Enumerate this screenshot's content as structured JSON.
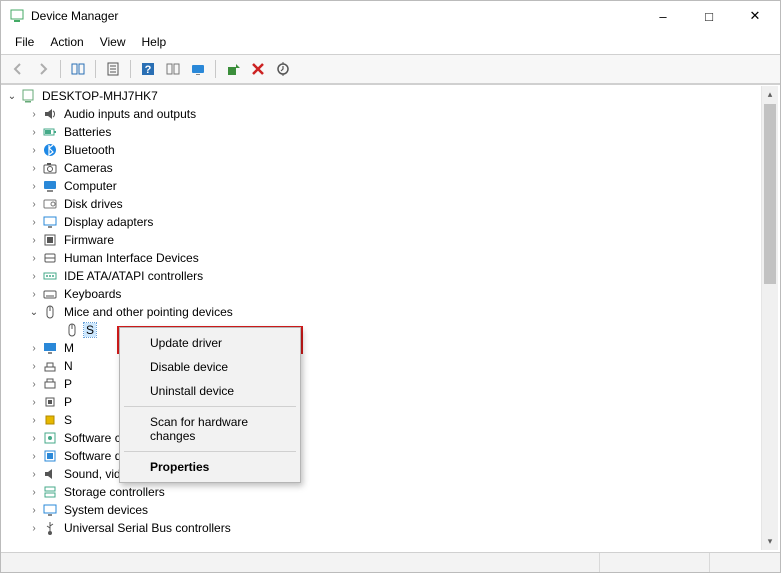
{
  "titlebar": {
    "title": "Device Manager"
  },
  "menubar": {
    "items": [
      "File",
      "Action",
      "View",
      "Help"
    ]
  },
  "toolbar": {
    "buttons": [
      {
        "name": "back",
        "enabled": false
      },
      {
        "name": "forward",
        "enabled": false
      },
      {
        "sep": true
      },
      {
        "name": "show-hide-tree",
        "enabled": true
      },
      {
        "sep": true
      },
      {
        "name": "properties",
        "enabled": true
      },
      {
        "sep": true
      },
      {
        "name": "help",
        "enabled": true
      },
      {
        "name": "show-hidden",
        "enabled": true
      },
      {
        "name": "computer-props",
        "enabled": true
      },
      {
        "sep": true
      },
      {
        "name": "update-driver",
        "enabled": true
      },
      {
        "name": "uninstall",
        "enabled": true
      },
      {
        "name": "scan-hardware",
        "enabled": true
      }
    ]
  },
  "tree": {
    "root": {
      "label": "DESKTOP-MHJ7HK7",
      "expanded": true
    },
    "categories": [
      {
        "label": "Audio inputs and outputs",
        "icon": "audio"
      },
      {
        "label": "Batteries",
        "icon": "battery"
      },
      {
        "label": "Bluetooth",
        "icon": "bluetooth"
      },
      {
        "label": "Cameras",
        "icon": "camera"
      },
      {
        "label": "Computer",
        "icon": "computer"
      },
      {
        "label": "Disk drives",
        "icon": "disk"
      },
      {
        "label": "Display adapters",
        "icon": "display"
      },
      {
        "label": "Firmware",
        "icon": "firmware"
      },
      {
        "label": "Human Interface Devices",
        "icon": "hid"
      },
      {
        "label": "IDE ATA/ATAPI controllers",
        "icon": "ide"
      },
      {
        "label": "Keyboards",
        "icon": "keyboard"
      },
      {
        "label": "Mice and other pointing devices",
        "icon": "mouse",
        "expanded": true,
        "children": [
          {
            "label": "S",
            "icon": "mouse",
            "truncated": true,
            "selected": true
          }
        ]
      },
      {
        "label": "M",
        "icon": "monitor",
        "truncated": true
      },
      {
        "label": "N",
        "icon": "network",
        "truncated": true
      },
      {
        "label": "P",
        "icon": "print-queue",
        "truncated": true
      },
      {
        "label": "P",
        "icon": "processor",
        "truncated": true
      },
      {
        "label": "S",
        "icon": "security",
        "truncated": true
      },
      {
        "label": "Software components",
        "icon": "software-comp"
      },
      {
        "label": "Software devices",
        "icon": "software-dev"
      },
      {
        "label": "Sound, video and game controllers",
        "icon": "sound"
      },
      {
        "label": "Storage controllers",
        "icon": "storage"
      },
      {
        "label": "System devices",
        "icon": "system"
      },
      {
        "label": "Universal Serial Bus controllers",
        "icon": "usb",
        "truncated": true
      }
    ]
  },
  "context_menu": {
    "items": [
      {
        "label": "Update driver",
        "highlight": true
      },
      {
        "label": "Disable device"
      },
      {
        "label": "Uninstall device"
      },
      {
        "sep": true
      },
      {
        "label": "Scan for hardware changes"
      },
      {
        "sep": true
      },
      {
        "label": "Properties",
        "bold": true
      }
    ]
  }
}
